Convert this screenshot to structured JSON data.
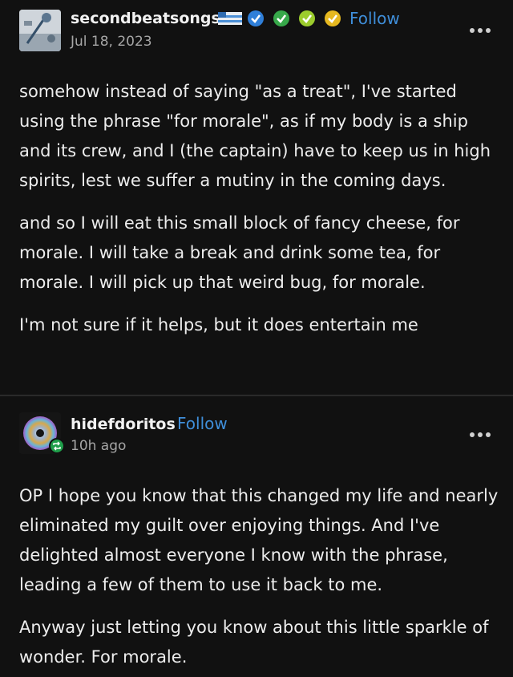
{
  "post": {
    "username": "secondbeatsongs",
    "date": "Jul 18, 2023",
    "follow_label": "Follow",
    "paragraphs": [
      "somehow instead of saying \"as a treat\", I've started using the phrase \"for morale\", as if my body is a ship and its crew, and I (the captain) have to keep us in high spirits, lest we suffer a mutiny in the coming days.",
      "and so I will eat this small block of fancy cheese, for morale. I will take a break and drink some tea, for morale. I will pick up that weird bug, for morale.",
      "I'm not sure if it helps, but it does entertain me"
    ]
  },
  "reply": {
    "username": "hidefdoritos",
    "time": "10h ago",
    "follow_label": "Follow",
    "paragraphs": [
      "OP I hope you know that this changed my life and nearly eliminated my guilt over enjoying things. And I've delighted almost everyone I know with the phrase, leading a few of them to use it back to me.",
      "Anyway just letting you know about this little sparkle of wonder. For morale."
    ]
  },
  "icons": {
    "verified_badges": [
      "blue-check-badge-icon",
      "green-check-badge-icon",
      "lime-check-badge-icon",
      "yellow-check-badge-icon"
    ],
    "more": "more-options-icon",
    "reblog": "reblog-icon"
  },
  "colors": {
    "background": "#111111",
    "follow": "#3f8ed9",
    "badge_blue": "#2f7fd9",
    "badge_green": "#37a84a",
    "badge_lime": "#9ccc2d",
    "badge_yellow": "#e6b820"
  }
}
